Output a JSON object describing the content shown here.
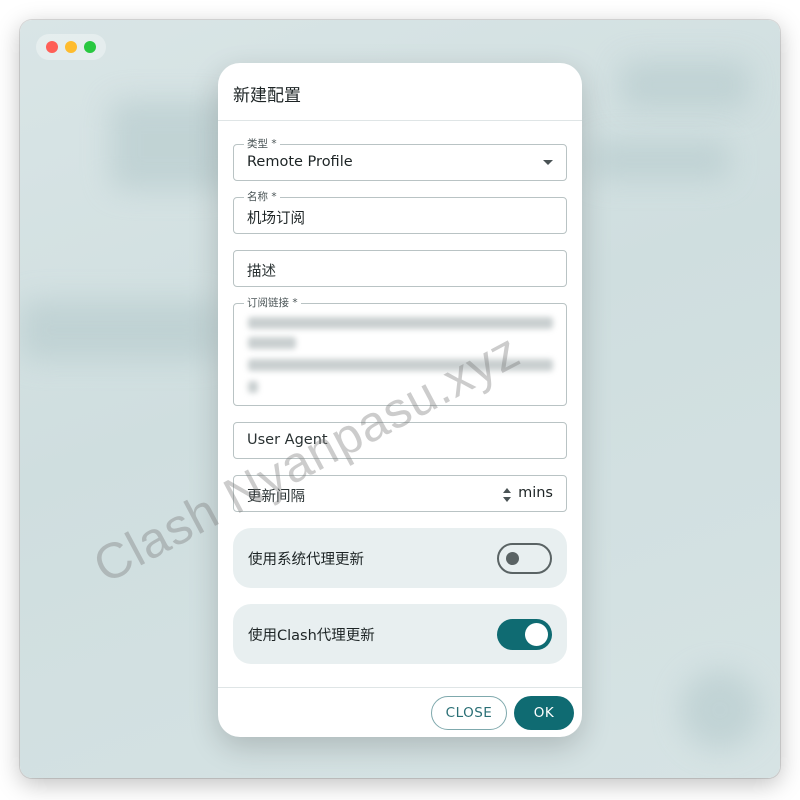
{
  "dialog": {
    "title": "新建配置",
    "fields": {
      "type": {
        "label": "类型 *",
        "value": "Remote Profile"
      },
      "name": {
        "label": "名称 *",
        "value": "机场订阅"
      },
      "description": {
        "placeholder": "描述"
      },
      "subscription_url": {
        "label": "订阅链接 *"
      },
      "user_agent": {
        "placeholder": "User Agent"
      },
      "update_interval": {
        "placeholder": "更新间隔",
        "suffix": "mins"
      }
    },
    "switches": {
      "system_proxy": {
        "label": "使用系统代理更新",
        "checked": false
      },
      "clash_proxy": {
        "label": "使用Clash代理更新",
        "checked": true
      }
    },
    "buttons": {
      "close": "CLOSE",
      "ok": "OK"
    }
  },
  "watermark": "Clash Nyanpasu.xyz",
  "colors": {
    "accent": "#0f6b72",
    "switch_track_off": "#e8eff0"
  },
  "icons": [
    "dropdown-caret-icon",
    "stepper-icon"
  ]
}
